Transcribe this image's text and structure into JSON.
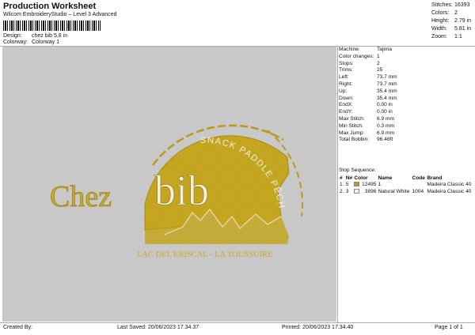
{
  "header": {
    "title": "Production Worksheet",
    "subtitle": "Wilcom EmbroideryStudio – Level 3 Advanced",
    "barcode_text": "3",
    "design_label": "Design:",
    "design_value": "chez bib 5,8 in",
    "colorway_label": "Colorway:",
    "colorway_value": "Colorway 1"
  },
  "stats": [
    {
      "label": "Stitches:",
      "value": "16393"
    },
    {
      "label": "Colors:",
      "value": "2"
    },
    {
      "label": "Height:",
      "value": "2.79 in"
    },
    {
      "label": "Width:",
      "value": "5.81 in"
    },
    {
      "label": "Zoom:",
      "value": "1:1"
    }
  ],
  "info": [
    {
      "label": "Machine:",
      "value": "Tajima"
    },
    {
      "label": "Color changes:",
      "value": "1"
    },
    {
      "label": "Stops:",
      "value": "2"
    },
    {
      "label": "Trims:",
      "value": "25"
    },
    {
      "label": "Left:",
      "value": "73.7 mm"
    },
    {
      "label": "Right:",
      "value": "73.7 mm"
    },
    {
      "label": "Up:",
      "value": "35.4 mm"
    },
    {
      "label": "Down:",
      "value": "35.4 mm"
    },
    {
      "label": "EndX:",
      "value": "0.00 in"
    },
    {
      "label": "EndY:",
      "value": "0.00 in"
    },
    {
      "label": "Max Stitch:",
      "value": "6.9 mm"
    },
    {
      "label": "Min Stitch:",
      "value": "0.3 mm"
    },
    {
      "label": "Max Jump:",
      "value": "6.9 mm"
    },
    {
      "label": "Total Bobbin:",
      "value": "96.48ft"
    }
  ],
  "sequence": {
    "title": "Stop Sequence:",
    "headers": [
      "#",
      "N#",
      "Color",
      "Name",
      "Code",
      "Brand"
    ],
    "rows": [
      {
        "idx": "1.",
        "n": "5",
        "color": "#b99a2a",
        "stitches": "12495",
        "name": "1",
        "code": "",
        "brand": "Madeira Classic 40"
      },
      {
        "idx": "2.",
        "n": "3",
        "color": "#f3efe0",
        "stitches": "3896",
        "name": "Natural White",
        "code": "1004",
        "brand": "Madeira Classic 40"
      }
    ]
  },
  "design": {
    "logo_main": "Chez",
    "logo_bib": "bib",
    "arc_text": "SNACK PADDLE PÊCHE",
    "bottom_text": "LAC DEL'ERISCAL - LA TOUSSUIRE",
    "gold": "#c9aa22"
  },
  "footer": {
    "created_by": "Created By:",
    "last_saved": "Last Saved: 20/06/2023 17.34.37",
    "printed": "Printed: 20/06/2023 17.34.40",
    "page": "Page 1 of 1"
  }
}
